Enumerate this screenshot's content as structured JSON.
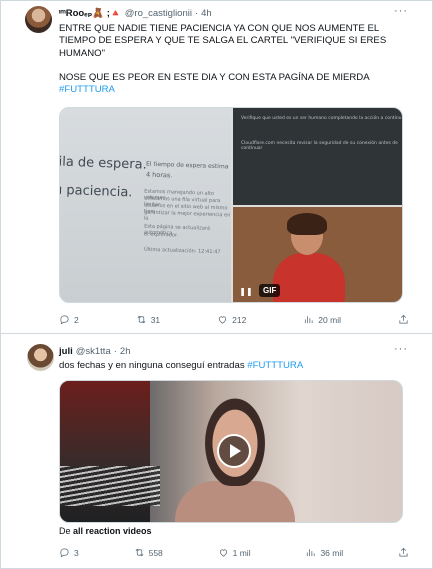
{
  "tweets": [
    {
      "display_name": "ᶦᵐRooₑₚ🧸 ;🔺",
      "handle": "@ro_castiglionii",
      "dot": "·",
      "time": "4h",
      "more": "···",
      "text_lines": [
        "ENTRE QUE NADIE TIENE PACIENCIA YA CON QUE NOS AUMENTE EL",
        "TIEMPO DE ESPERA  Y QUE TE SALGA EL CARTEL \"VERIFIQUE SI ERES",
        "HUMANO\""
      ],
      "text_line2": "NOSE QUE ES PEOR EN ESTE DIA Y CON ESTA PAGÍNA  DE MIERDA",
      "hashtag": "#FUTTTURA",
      "media": {
        "photo1_big1": "fila de espera.",
        "photo1_big2": "u paciencia.",
        "photo1_right_title": "El tiempo de espera estima",
        "photo1_right_sub": "4 horas.",
        "photo1_small": [
          "Estamos manejando un alto volumen",
          "utilizamos una fila virtual para limitar",
          "usuarios en el sitio web al mismo tiem",
          "garantizar la mejor experiencia en la",
          "Esta página se actualizará automática",
          "el explorador."
        ],
        "photo1_update": "Última actualización: 12:41:47",
        "photo2_line1": "Verifique que usted es un ser humano completando la acción a continu",
        "photo2_line2": "Cloudflare.com necesita revisar la seguridad de su conexión antes de continuar",
        "gif_label": "GIF",
        "pause_icon": "❚❚"
      },
      "actions": {
        "replies": "2",
        "retweets": "31",
        "likes": "212",
        "views": "20 mil"
      }
    },
    {
      "display_name": "juli",
      "handle": "@sk1tta",
      "dot": "·",
      "time": "2h",
      "more": "···",
      "text": "dos fechas y en ninguna conseguí entradas",
      "hashtag": "#FUTTTURA",
      "attribution_prefix": "De",
      "attribution_source": "all reaction videos",
      "actions": {
        "replies": "3",
        "retweets": "558",
        "likes": "1 mil",
        "views": "36 mil"
      }
    }
  ]
}
